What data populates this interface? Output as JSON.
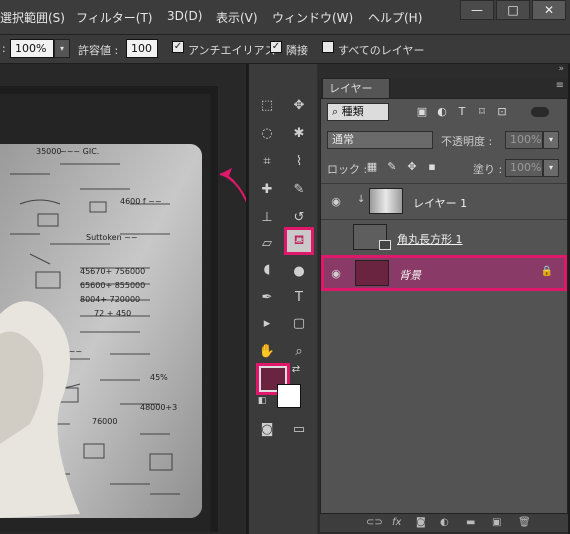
{
  "menubar": {
    "items": [
      "選択範囲(S)",
      "フィルター(T)",
      "3D(D)",
      "表示(V)",
      "ウィンドウ(W)",
      "ヘルプ(H)"
    ],
    "window_buttons": [
      "—",
      "□",
      "✕"
    ]
  },
  "optionsbar": {
    "colon": ":",
    "opacity_value": "100%",
    "tolerance_label": "許容値 :",
    "tolerance_value": "100",
    "antialias_label": "アンチエイリアス",
    "contiguous_label": "隣接",
    "all_layers_label": "すべてのレイヤー",
    "check": "✓"
  },
  "layers_panel": {
    "tab_label": "レイヤー",
    "filter_label": "種類",
    "blend_mode": "通常",
    "opacity_label": "不透明度 :",
    "opacity_value": "100%",
    "lock_label": "ロック :",
    "fill_label": "塗り :",
    "fill_value": "100%",
    "layers": [
      {
        "name": "レイヤー 1",
        "visible": true,
        "selected": false
      },
      {
        "name": "角丸長方形 1",
        "visible": false,
        "selected": false
      },
      {
        "name": "背景",
        "visible": true,
        "selected": true
      }
    ]
  },
  "colors": {
    "foreground": "#6a2440",
    "background": "#ffffff",
    "highlight": "#e0186c"
  },
  "icons": {
    "eye": "eye-icon",
    "lock": "lock-icon",
    "paint_bucket": "paint-bucket-icon"
  }
}
